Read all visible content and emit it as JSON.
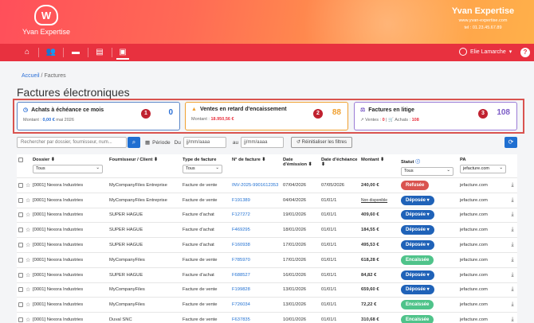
{
  "header": {
    "logo_mark": "W",
    "logo_text": "Yvan Expertise",
    "brand_name": "Yvan Expertise",
    "brand_url": "www.yvan-expertise.com",
    "brand_tel": "tel : 01.23.45.67.89"
  },
  "nav": {
    "user_name": "Elie Lamarche",
    "help": "?"
  },
  "breadcrumb": {
    "home": "Accueil",
    "sep": "/",
    "current": "Factures"
  },
  "page_title": "Factures électroniques",
  "cards": [
    {
      "title": "Achats à échéance ce mois",
      "number": "1",
      "value": "0",
      "sub_label": "Montant :",
      "sub_amount": "0,00 €",
      "sub_extra": "mai 2026",
      "color": "#2a6fd6"
    },
    {
      "title": "Ventes en retard d'encaissement",
      "number": "2",
      "value": "88",
      "sub_label": "Montant :",
      "sub_amount": "18.950,56 €",
      "color": "#f0a030"
    },
    {
      "title": "Factures en litige",
      "number": "3",
      "value": "108",
      "sub_ventes_label": "Ventes :",
      "sub_ventes": "0",
      "sub_sep": "|",
      "sub_achats_label": "Achats :",
      "sub_achats": "108",
      "color": "#7b5bc6"
    }
  ],
  "filters": {
    "search_placeholder": "Rechercher par dossier, fournisseur, num...",
    "periode_label": "Période",
    "du_label": "Du",
    "au_label": "au",
    "date_placeholder": "jj/mm/aaaa",
    "reset_label": "Réinitialiser les filtres"
  },
  "table": {
    "headers": {
      "dossier": "Dossier ⬍",
      "fournisseur": "Fournisseur / Client ⬍",
      "type": "Type de facture",
      "numero": "N° de facture ⬍",
      "emission": "Date d'émission ⬍",
      "echeance": "Date d'échéance ⬍",
      "montant": "Montant ⬍",
      "statut": "Statut",
      "pa": "PA"
    },
    "header_filters": {
      "dossier": "Tous",
      "type": "Tous",
      "statut": "Tous",
      "pa": "jefacture.com"
    },
    "rows": [
      {
        "dossier": "[0001] Nexora Industries",
        "fournisseur": "MyCompanyFiles Entreprise",
        "type": "Facture de vente",
        "numero": "INV-2025-9901612353",
        "emission": "07/04/2026",
        "echeance": "07/05/2026",
        "montant": "240,00 €",
        "statut": "Refusée",
        "statut_kind": "refusee",
        "pa": "jefacture.com"
      },
      {
        "dossier": "[0001] Nexora Industries",
        "fournisseur": "MyCompanyFiles Entreprise",
        "type": "Facture de vente",
        "numero": "F191389",
        "emission": "04/04/2026",
        "echeance": "01/01/1",
        "montant": "Non disponible",
        "statut": "Déposée",
        "statut_kind": "deposee",
        "pa": "jefacture.com"
      },
      {
        "dossier": "[0001] Nexora Industries",
        "fournisseur": "SUPER HAGUE",
        "type": "Facture d'achat",
        "numero": "F127272",
        "emission": "19/01/2026",
        "echeance": "01/01/1",
        "montant": "409,60 €",
        "statut": "Déposée",
        "statut_kind": "deposee",
        "pa": "jefacture.com"
      },
      {
        "dossier": "[0001] Nexora Industries",
        "fournisseur": "SUPER HAGUE",
        "type": "Facture d'achat",
        "numero": "F469295",
        "emission": "18/01/2026",
        "echeance": "01/01/1",
        "montant": "184,55 €",
        "statut": "Déposée",
        "statut_kind": "deposee",
        "pa": "jefacture.com"
      },
      {
        "dossier": "[0001] Nexora Industries",
        "fournisseur": "SUPER HAGUE",
        "type": "Facture d'achat",
        "numero": "F160938",
        "emission": "17/01/2026",
        "echeance": "01/01/1",
        "montant": "495,53 €",
        "statut": "Déposée",
        "statut_kind": "deposee",
        "pa": "jefacture.com"
      },
      {
        "dossier": "[0001] Nexora Industries",
        "fournisseur": "MyCompanyFiles",
        "type": "Facture de vente",
        "numero": "F785970",
        "emission": "17/01/2026",
        "echeance": "01/01/1",
        "montant": "618,28 €",
        "statut": "Encaissée",
        "statut_kind": "encaissee",
        "pa": "jefacture.com"
      },
      {
        "dossier": "[0001] Nexora Industries",
        "fournisseur": "SUPER HAGUE",
        "type": "Facture d'achat",
        "numero": "F688527",
        "emission": "16/01/2026",
        "echeance": "01/01/1",
        "montant": "84,82 €",
        "statut": "Déposée",
        "statut_kind": "deposee",
        "pa": "jefacture.com"
      },
      {
        "dossier": "[0001] Nexora Industries",
        "fournisseur": "MyCompanyFiles",
        "type": "Facture de vente",
        "numero": "F199828",
        "emission": "13/01/2026",
        "echeance": "01/01/1",
        "montant": "659,60 €",
        "statut": "Déposée",
        "statut_kind": "deposee",
        "pa": "jefacture.com"
      },
      {
        "dossier": "[0001] Nexora Industries",
        "fournisseur": "MyCompanyFiles",
        "type": "Facture de vente",
        "numero": "F726034",
        "emission": "13/01/2026",
        "echeance": "01/01/1",
        "montant": "72,22 €",
        "statut": "Encaissée",
        "statut_kind": "encaissee",
        "pa": "jefacture.com"
      },
      {
        "dossier": "[0001] Nexora Industries",
        "fournisseur": "Duval SNC",
        "type": "Facture de vente",
        "numero": "F637835",
        "emission": "10/01/2026",
        "echeance": "01/01/1",
        "montant": "310,68 €",
        "statut": "Encaissée",
        "statut_kind": "encaissee",
        "pa": "jefacture.com"
      }
    ]
  }
}
